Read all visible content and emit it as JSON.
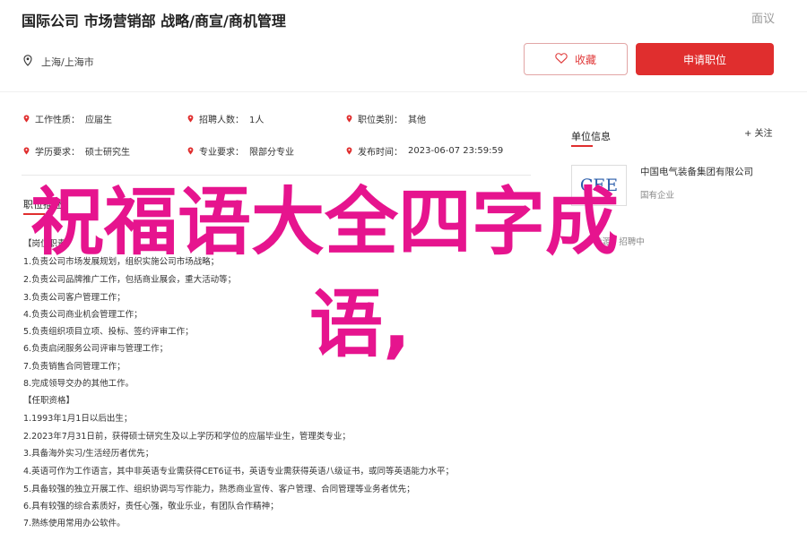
{
  "header": {
    "title": "国际公司 市场营销部 战略/商宣/商机管理",
    "report_label": "面议",
    "location_icon": "location-pin-icon",
    "location": "上海/上海市",
    "favorite_label": "收藏",
    "apply_label": "申请职位"
  },
  "info": {
    "row1": [
      {
        "label": "工作性质：",
        "value": "应届生"
      },
      {
        "label": "招聘人数：",
        "value": "1人"
      },
      {
        "label": "职位类别：",
        "value": "其他"
      }
    ],
    "row2": [
      {
        "label": "学历要求：",
        "value": "硕士研究生"
      },
      {
        "label": "专业要求：",
        "value": "限部分专业"
      },
      {
        "label": "发布时间：",
        "value": "2023-06-07 23:59:59"
      }
    ]
  },
  "description": {
    "heading": "职位描述",
    "lines": [
      "【岗位职责】",
      "1.负责公司市场发展规划，组织实施公司市场战略；",
      "2.负责公司品牌推广工作，包括商业展会，重大活动等；",
      "3.负责公司客户管理工作；",
      "4.负责公司商业机会管理工作；",
      "5.负责组织项目立项、投标、签约评审工作；",
      "6.负责启闭服务公司评审与管理工作；",
      "7.负责销售合同管理工作；",
      "8.完成领导交办的其他工作。",
      "【任职资格】",
      "1.1993年1月1日以后出生；",
      "2.2023年7月31日前，获得硕士研究生及以上学历和学位的应届毕业生，管理类专业；",
      "3.具备海外实习/生活经历者优先；",
      "4.英语可作为工作语言，其中非英语专业需获得CET6证书，英语专业需获得英语八级证书，或同等英语能力水平；",
      "5.具备较强的独立开展工作、组织协调与写作能力，熟悉商业宣传、客户管理、合同管理等业务者优先；",
      "6.具有较强的综合素质好，责任心强，敬业乐业，有团队合作精神；",
      "7.熟练使用常用办公软件。"
    ]
  },
  "sidebar": {
    "title": "单位信息",
    "follow_label": "+ 关注",
    "logo_text": "CEE",
    "company_name": "中国电气装备集团有限公司",
    "company_sub": "国有企业",
    "company_sub2": "能源 | 招聘中"
  },
  "overlay": {
    "line1": "祝福语大全四字成",
    "line2": "语,"
  },
  "colors": {
    "accent": "#e02e2e",
    "overlay": "#e6148e"
  }
}
